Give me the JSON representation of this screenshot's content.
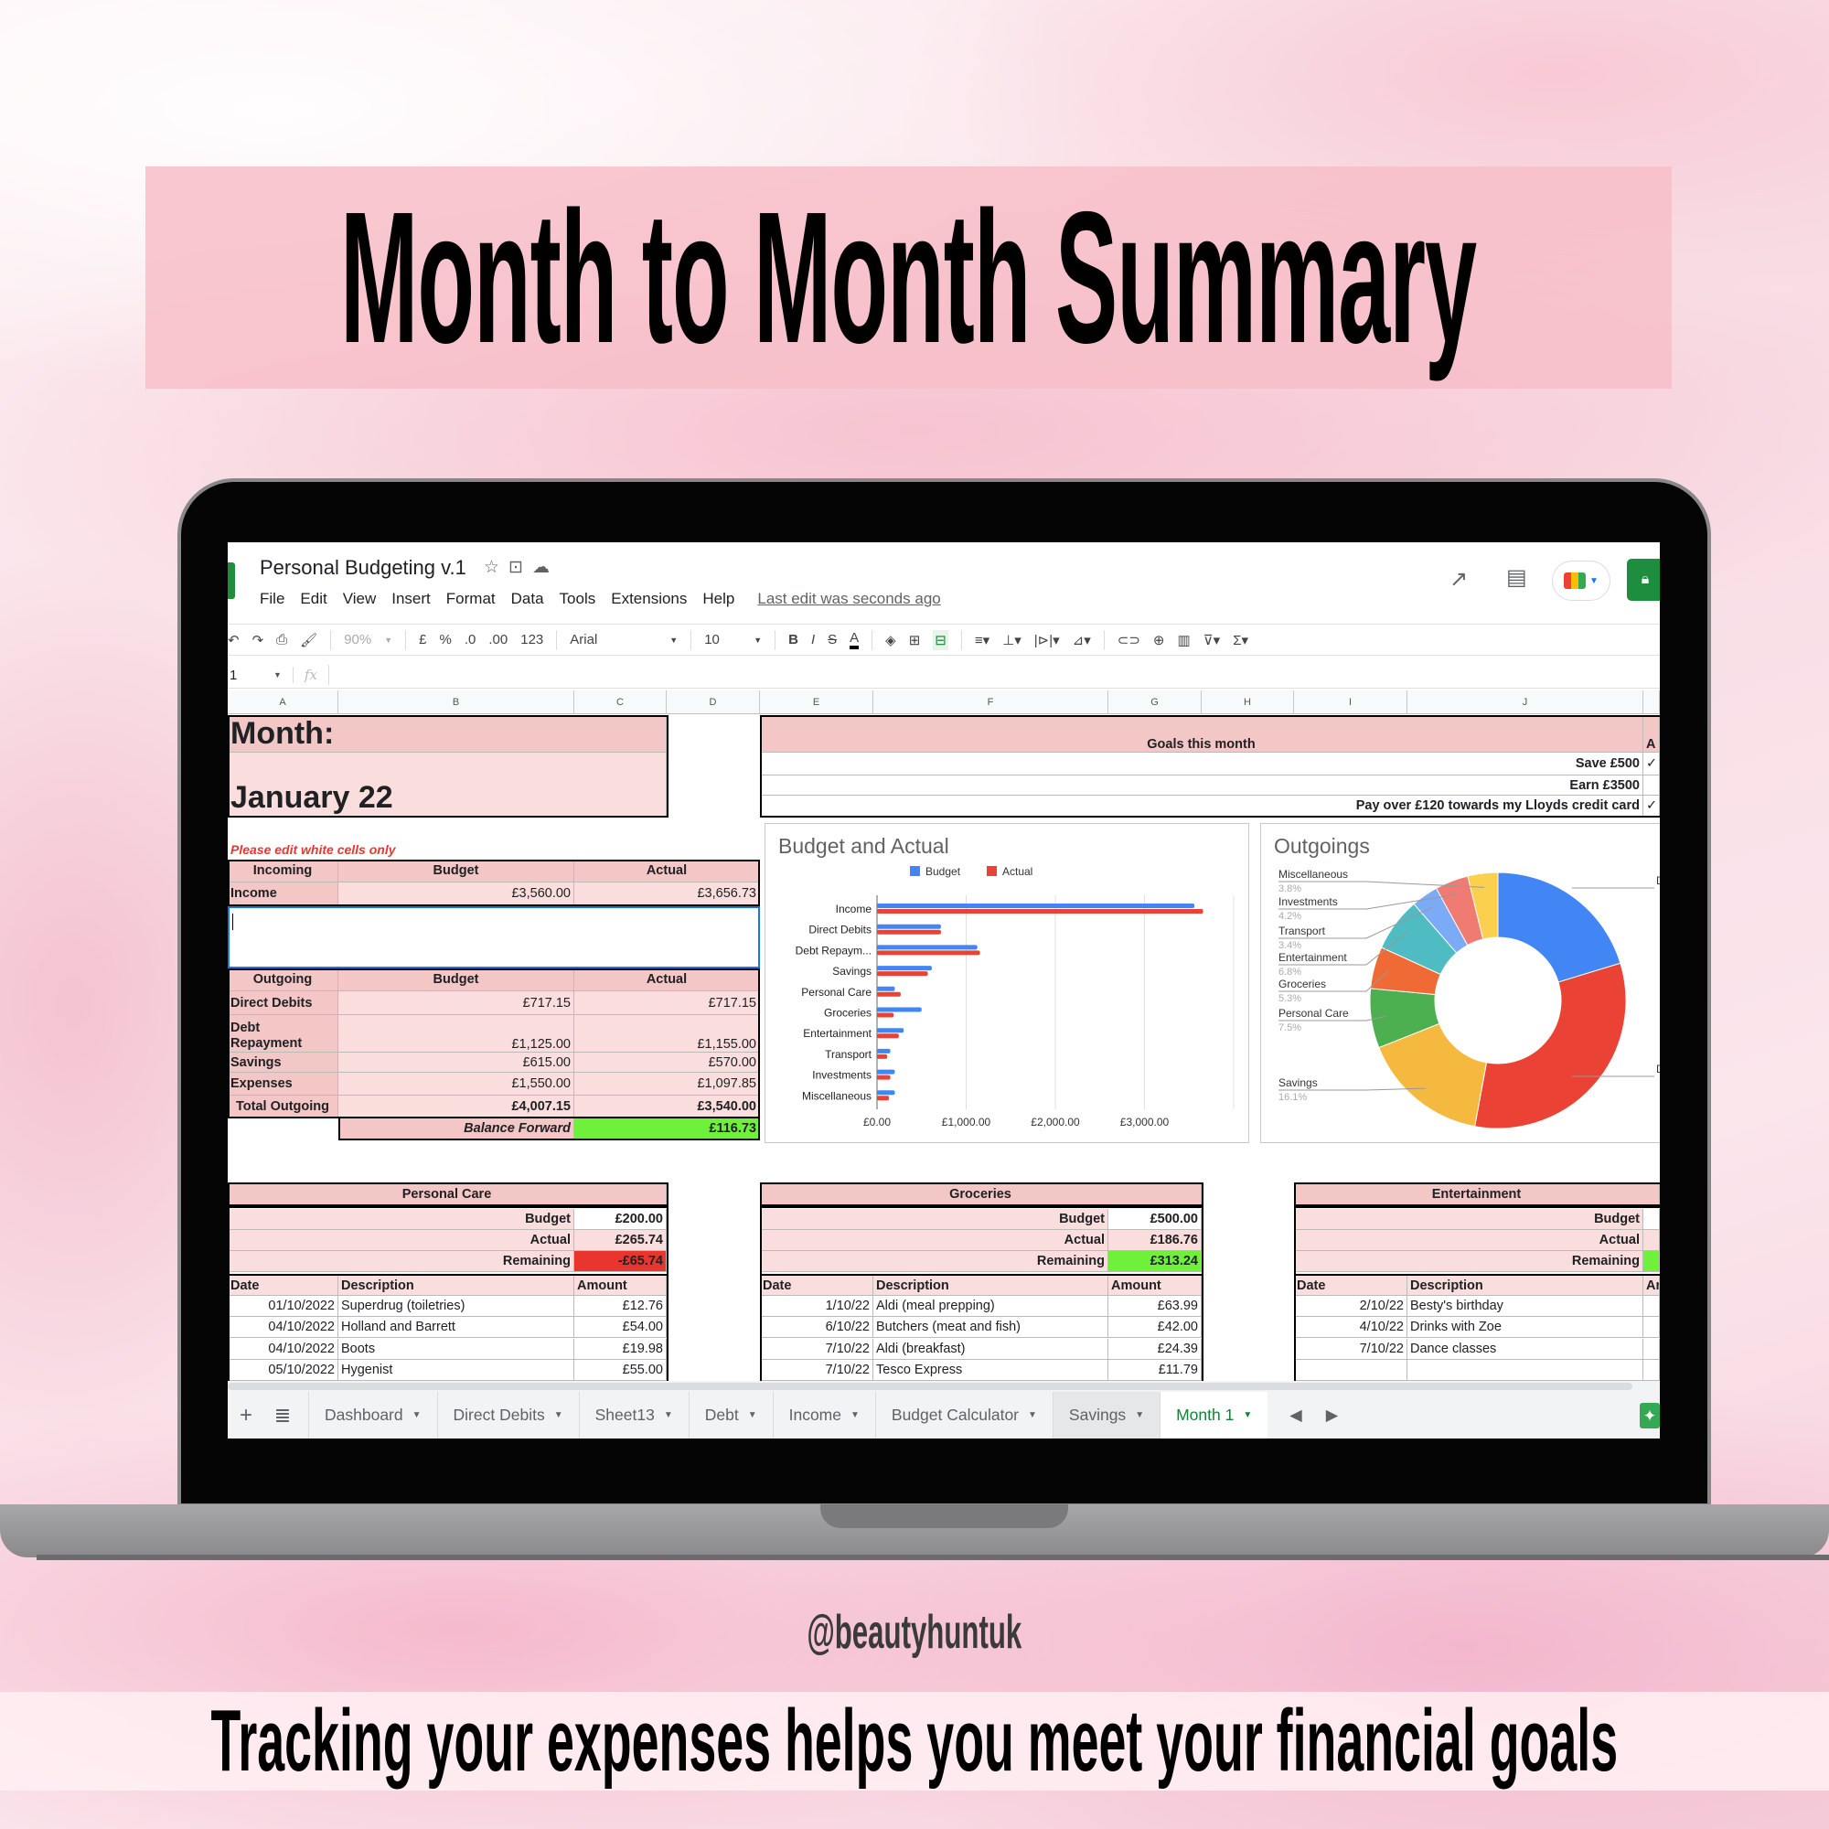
{
  "banner": {
    "title": "Month to Month Summary"
  },
  "handle": "@beautyhuntuk",
  "tagline": "Tracking your expenses helps you meet your financial goals",
  "app": {
    "doc_title": "Personal Budgeting v.1",
    "menu": [
      "File",
      "Edit",
      "View",
      "Insert",
      "Format",
      "Data",
      "Tools",
      "Extensions",
      "Help"
    ],
    "last_edit": "Last edit was seconds ago",
    "toolbar": {
      "zoom": "90%",
      "currency": "£",
      "percent": "%",
      "dec_less": ".0",
      "dec_more": ".00",
      "format": "123",
      "font": "Arial",
      "size": "10",
      "bold": "B",
      "italic": "I",
      "strike": "S",
      "text_color": "A"
    },
    "name_box": "1",
    "fx": "fx",
    "columns": [
      "A",
      "B",
      "C",
      "D",
      "E",
      "F",
      "G",
      "H",
      "I",
      "J"
    ]
  },
  "month": {
    "label": "Month:",
    "value": "January 22"
  },
  "goals": {
    "header": "Goals this month",
    "achieved_header": "A",
    "items": [
      {
        "text": "Save £500",
        "done": "✓"
      },
      {
        "text": "Earn £3500",
        "done": ""
      },
      {
        "text": "Pay over £120 towards my Lloyds credit card",
        "done": "✓"
      }
    ]
  },
  "note": "Please edit white cells only",
  "incoming": {
    "headers": [
      "Incoming",
      "Budget",
      "Actual"
    ],
    "rows": [
      [
        "Income",
        "£3,560.00",
        "£3,656.73"
      ]
    ]
  },
  "outgoing": {
    "headers": [
      "Outgoing",
      "Budget",
      "Actual"
    ],
    "rows": [
      [
        "Direct Debits",
        "£717.15",
        "£717.15"
      ],
      [
        "Debt Repayment",
        "£1,125.00",
        "£1,155.00"
      ],
      [
        "Savings",
        "£615.00",
        "£570.00"
      ],
      [
        "Expenses",
        "£1,550.00",
        "£1,097.85"
      ]
    ],
    "total": [
      "Total Outgoing",
      "£4,007.15",
      "£3,540.00"
    ],
    "balance_label": "Balance Forward",
    "balance": "£116.73",
    "balance_color": "#6ff03a"
  },
  "chart_data": [
    {
      "type": "bar",
      "orientation": "horizontal",
      "title": "Budget and Actual",
      "legend": "top",
      "categories": [
        "Income",
        "Direct Debits",
        "Debt Repaym...",
        "Savings",
        "Personal Care",
        "Groceries",
        "Entertainment",
        "Transport",
        "Investments",
        "Miscellaneous"
      ],
      "series": [
        {
          "name": "Budget",
          "color": "#4285f4",
          "values": [
            3560,
            717.15,
            1125,
            615,
            200,
            500,
            300,
            150,
            200,
            200
          ]
        },
        {
          "name": "Actual",
          "color": "#ea4335",
          "values": [
            3656.73,
            717.15,
            1155,
            570,
            265.74,
            186.76,
            245,
            115,
            150,
            135
          ]
        }
      ],
      "xlim": [
        0,
        4000
      ],
      "xticks": [
        "£0.00",
        "£1,000.00",
        "£2,000.00",
        "£3,000.00"
      ],
      "xtick_values": [
        0,
        1000,
        2000,
        3000
      ],
      "grid": true
    },
    {
      "type": "pie",
      "donut": true,
      "title": "Outgoings",
      "slices": [
        {
          "label": "Direct Debits",
          "value": 20.3,
          "color": "#4285f4"
        },
        {
          "label": "Debt Repayment",
          "value": 32.6,
          "color": "#ea4335"
        },
        {
          "label": "Savings",
          "value": 16.1,
          "pct": "16.1%",
          "color": "#f6b940"
        },
        {
          "label": "Personal Care",
          "value": 7.5,
          "pct": "7.5%",
          "color": "#4caf50"
        },
        {
          "label": "Groceries",
          "value": 5.3,
          "pct": "5.3%",
          "color": "#f06a35"
        },
        {
          "label": "Entertainment",
          "value": 6.8,
          "pct": "6.8%",
          "color": "#4fbcc4"
        },
        {
          "label": "Transport",
          "value": 3.4,
          "pct": "3.4%",
          "color": "#7baaf7"
        },
        {
          "label": "Investments",
          "value": 4.2,
          "pct": "4.2%",
          "color": "#f07b72"
        },
        {
          "label": "Miscellaneous",
          "value": 3.8,
          "pct": "3.8%",
          "color": "#fcd04f"
        }
      ],
      "right_labels": [
        "Di",
        "Det"
      ]
    }
  ],
  "categories": [
    {
      "title": "Personal Care",
      "budget": "£200.00",
      "actual": "£265.74",
      "remaining": "-£65.74",
      "remaining_color": "#e8362e",
      "headers": [
        "Date",
        "Description",
        "Amount"
      ],
      "rows": [
        [
          "01/10/2022",
          "Superdrug (toiletries)",
          "£12.76"
        ],
        [
          "04/10/2022",
          "Holland and Barrett",
          "£54.00"
        ],
        [
          "04/10/2022",
          "Boots",
          "£19.98"
        ],
        [
          "05/10/2022",
          "Hygenist",
          "£55.00"
        ]
      ]
    },
    {
      "title": "Groceries",
      "budget": "£500.00",
      "actual": "£186.76",
      "remaining": "£313.24",
      "remaining_color": "#6ff03a",
      "headers": [
        "Date",
        "Description",
        "Amount"
      ],
      "rows": [
        [
          "1/10/22",
          "Aldi (meal prepping)",
          "£63.99"
        ],
        [
          "6/10/22",
          "Butchers (meat and fish)",
          "£42.00"
        ],
        [
          "7/10/22",
          "Aldi (breakfast)",
          "£24.39"
        ],
        [
          "7/10/22",
          "Tesco Express",
          "£11.79"
        ]
      ]
    },
    {
      "title": "Entertainment",
      "budget": "",
      "actual": "",
      "remaining": "",
      "remaining_color": "#6ff03a",
      "headers": [
        "Date",
        "Description",
        "Ar"
      ],
      "rows": [
        [
          "2/10/22",
          "Besty's birthday",
          ""
        ],
        [
          "4/10/22",
          "Drinks with Zoe",
          ""
        ],
        [
          "7/10/22",
          "Dance classes",
          ""
        ],
        [
          "",
          "",
          ""
        ]
      ]
    }
  ],
  "labels": {
    "budget": "Budget",
    "actual": "Actual",
    "remaining": "Remaining"
  },
  "sheet_tabs": [
    {
      "label": "Dashboard"
    },
    {
      "label": "Direct Debits"
    },
    {
      "label": "Sheet13"
    },
    {
      "label": "Debt"
    },
    {
      "label": "Income"
    },
    {
      "label": "Budget Calculator"
    },
    {
      "label": "Savings"
    },
    {
      "label": "Month 1",
      "active": true
    }
  ]
}
